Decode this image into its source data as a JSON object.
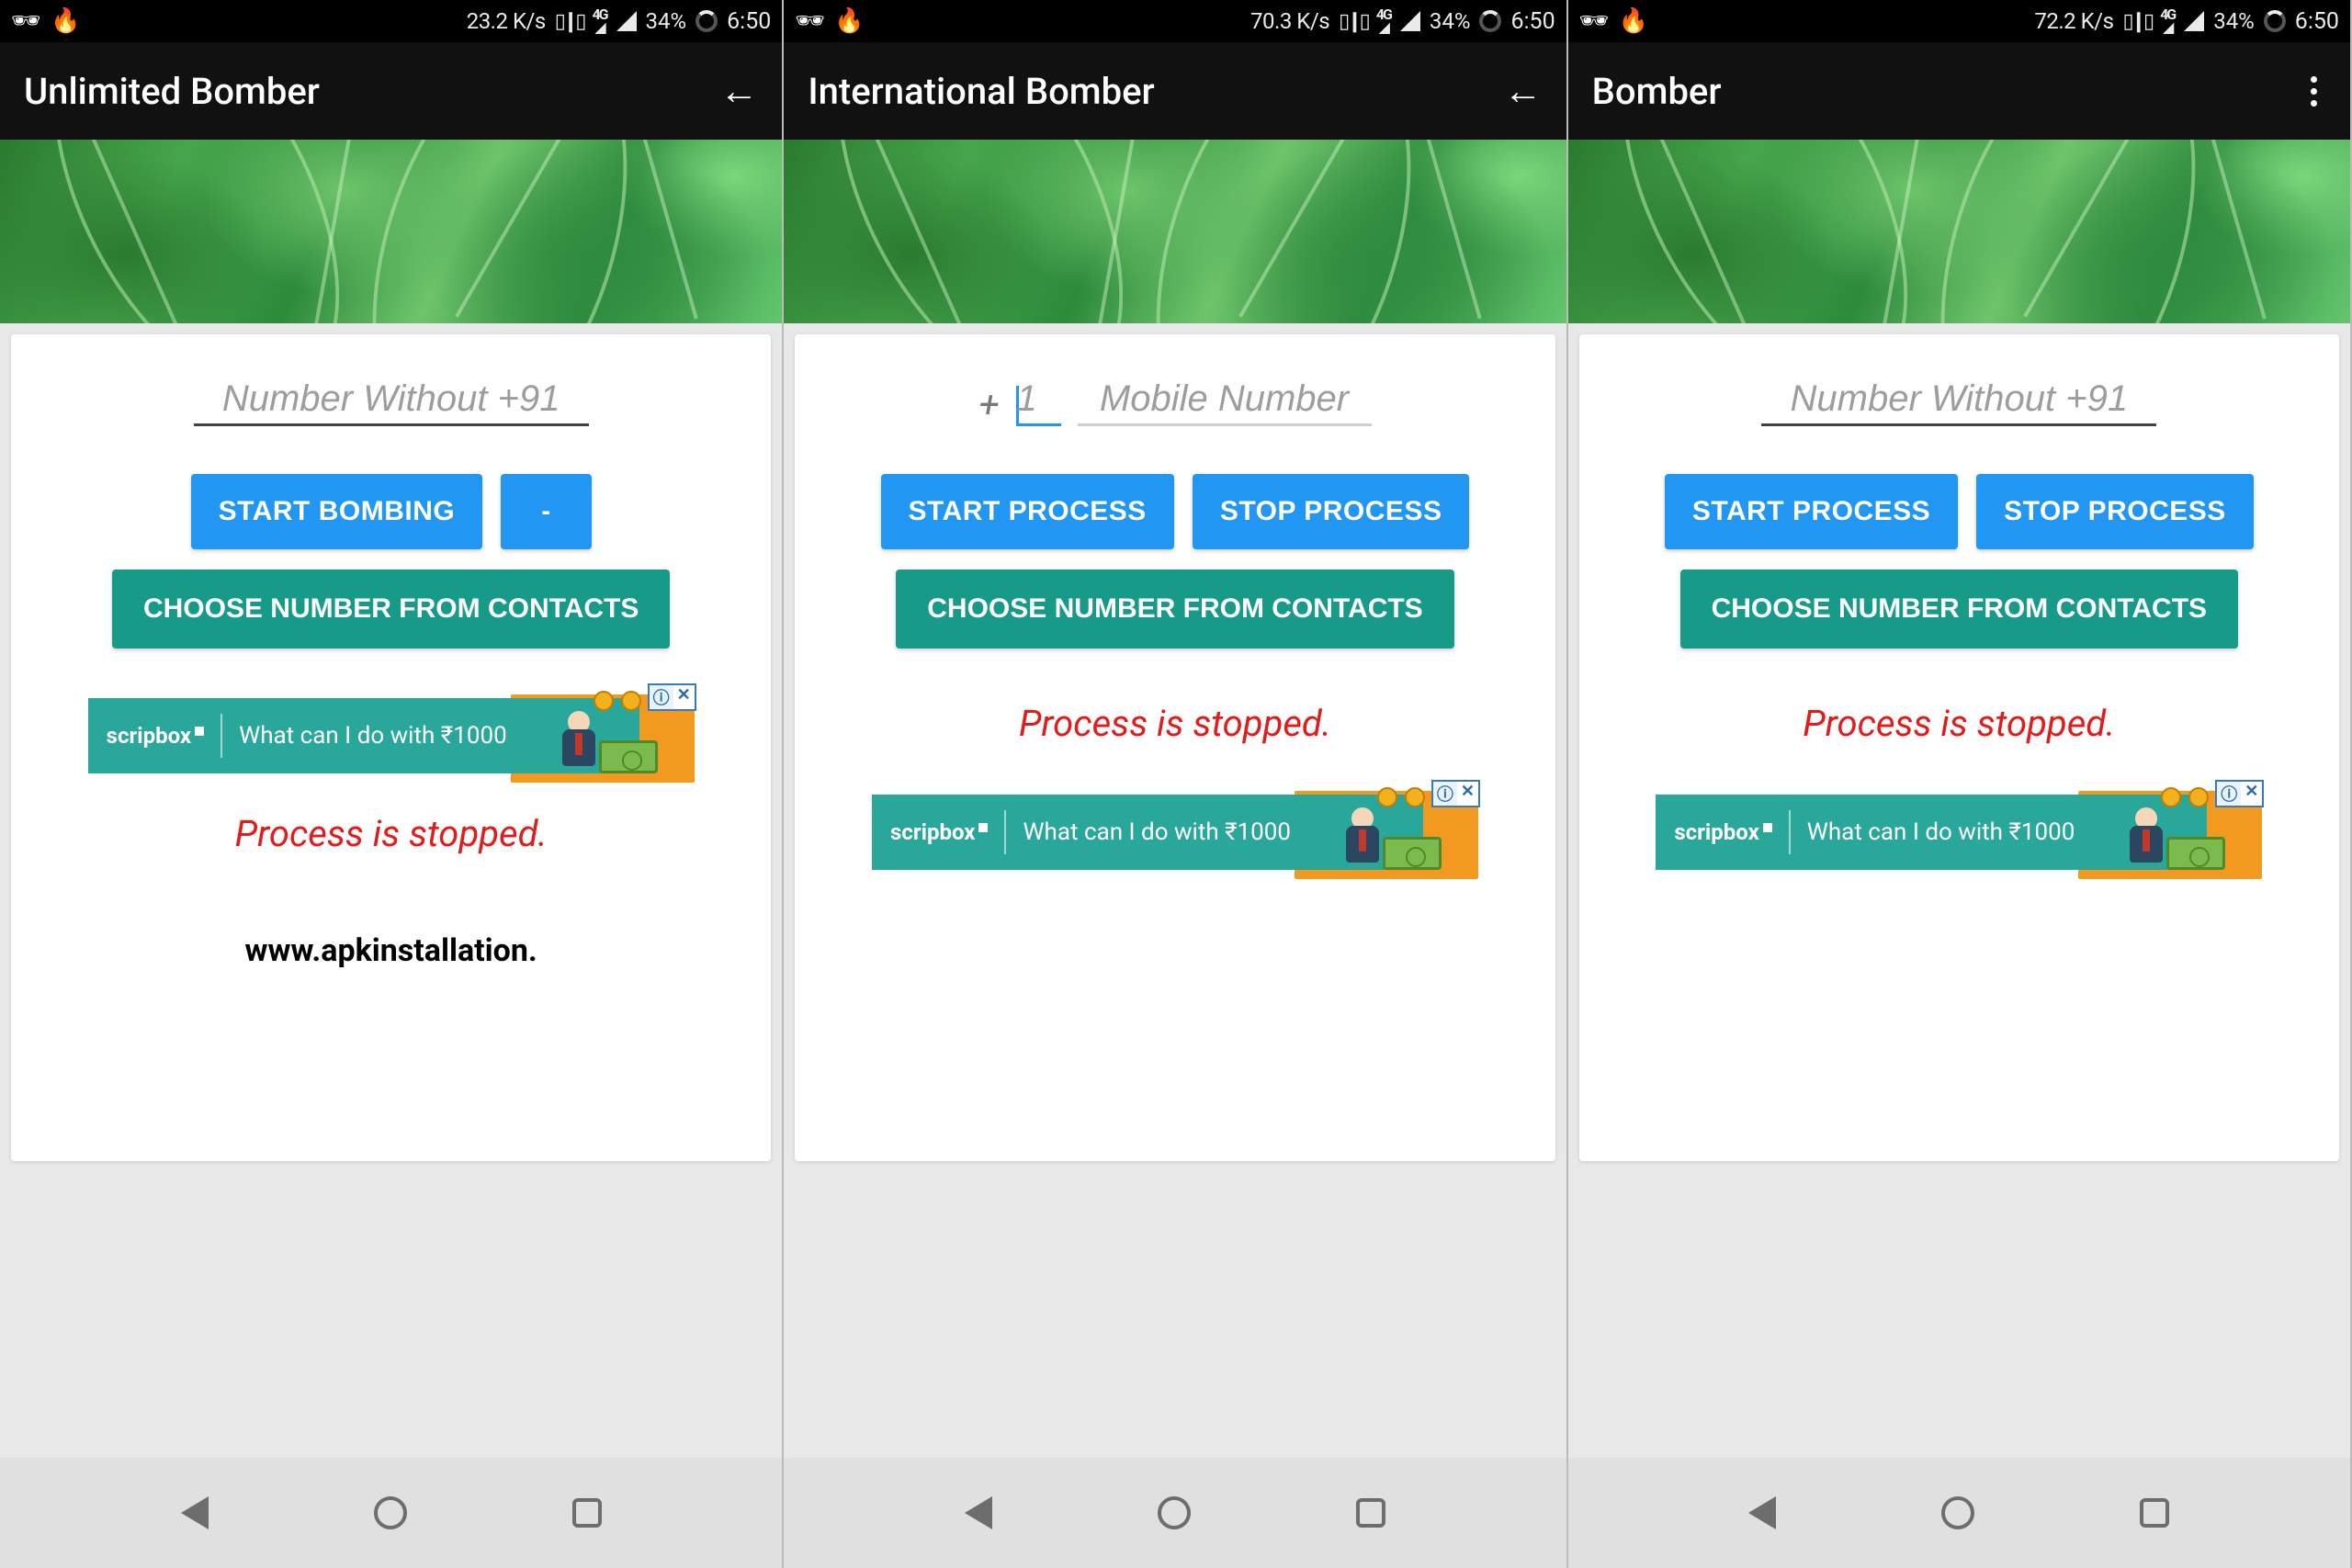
{
  "status_bar": {
    "battery": "34%",
    "time": "6:50",
    "net_label": "4G",
    "screens": [
      {
        "speed": "23.2 K/s"
      },
      {
        "speed": "70.3 K/s"
      },
      {
        "speed": "72.2 K/s"
      }
    ]
  },
  "screens": [
    {
      "title": "Unlimited Bomber",
      "action": "back",
      "input_mode": "single",
      "phone_placeholder": "Number Without +91",
      "buttons": {
        "primary": "START BOMBING",
        "secondary": "-"
      },
      "contacts_label": "CHOOSE NUMBER FROM CONTACTS",
      "status_text": "Process is stopped.",
      "promo": "www.apkinstallation.",
      "ad_first": true
    },
    {
      "title": "International Bomber",
      "action": "back",
      "input_mode": "intl",
      "plus": "+",
      "country_placeholder": "1",
      "phone_placeholder": "Mobile Number",
      "buttons": {
        "primary": "START PROCESS",
        "secondary": "STOP PROCESS"
      },
      "contacts_label": "CHOOSE NUMBER FROM CONTACTS",
      "status_text": "Process is stopped.",
      "ad_first": false
    },
    {
      "title": "Bomber",
      "action": "menu",
      "input_mode": "single",
      "phone_placeholder": "Number Without +91",
      "buttons": {
        "primary": "START PROCESS",
        "secondary": "STOP PROCESS"
      },
      "contacts_label": "CHOOSE NUMBER FROM CONTACTS",
      "status_text": "Process is stopped.",
      "ad_first": false
    }
  ],
  "ad": {
    "logo": "scripbox",
    "text": "What can I do with ₹1000",
    "info": "ⓘ",
    "close": "✕"
  }
}
